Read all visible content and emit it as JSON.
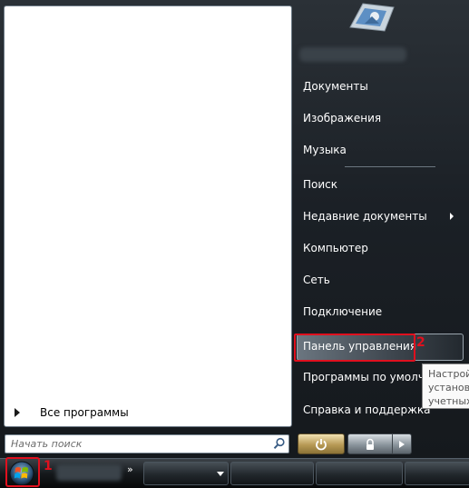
{
  "start_menu": {
    "left_pane": {
      "all_programs_label": "Все программы",
      "search_placeholder": "Начать поиск"
    },
    "right_pane": {
      "items": [
        {
          "label": "Документы"
        },
        {
          "label": "Изображения"
        },
        {
          "label": "Музыка"
        },
        {
          "label": "Поиск"
        },
        {
          "label": "Недавние документы",
          "has_submenu": true
        },
        {
          "label": "Компьютер"
        },
        {
          "label": "Сеть"
        },
        {
          "label": "Подключение"
        },
        {
          "label": "Панель управления",
          "highlighted": true
        },
        {
          "label": "Программы по умолча"
        },
        {
          "label": "Справка и поддержка"
        }
      ]
    },
    "tooltip": {
      "line1": "Настрой",
      "line2": "установ",
      "line3": "учетных"
    }
  },
  "annotations": {
    "marker_1": "1",
    "marker_2": "2"
  },
  "taskbar": {
    "overflow_glyph": "»"
  },
  "colors": {
    "highlight_border": "#e0101e",
    "menu_text": "#ffffff"
  }
}
